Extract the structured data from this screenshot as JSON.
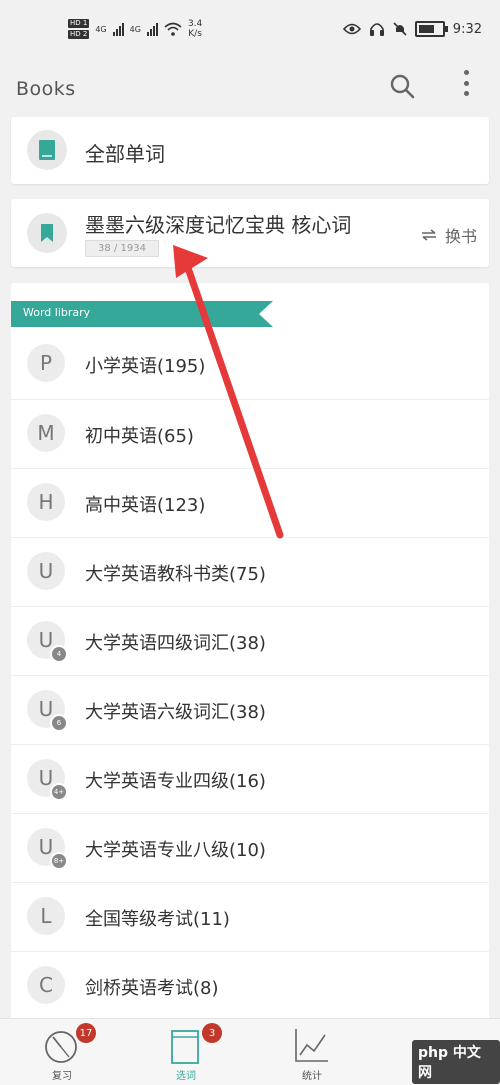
{
  "status_bar": {
    "sim_tags": [
      "HD 1",
      "HD 2"
    ],
    "network_labels": [
      "4G",
      "4G"
    ],
    "net_speed": "3.4",
    "net_speed_unit": "K/s",
    "battery_level": 0.85,
    "time": "9:32"
  },
  "app_bar": {
    "title": "Books"
  },
  "all_words": {
    "label": "全部单词"
  },
  "current_book": {
    "title": "墨墨六级深度记忆宝典 核心词",
    "progress": "38 / 1934",
    "switch_label": "换书"
  },
  "library": {
    "header": "Word library",
    "items": [
      {
        "letter": "P",
        "badge": "",
        "label": "小学英语(195)"
      },
      {
        "letter": "M",
        "badge": "",
        "label": "初中英语(65)"
      },
      {
        "letter": "H",
        "badge": "",
        "label": "高中英语(123)"
      },
      {
        "letter": "U",
        "badge": "",
        "label": "大学英语教科书类(75)"
      },
      {
        "letter": "U",
        "badge": "4",
        "label": "大学英语四级词汇(38)"
      },
      {
        "letter": "U",
        "badge": "6",
        "label": "大学英语六级词汇(38)"
      },
      {
        "letter": "U",
        "badge": "4+",
        "label": "大学英语专业四级(16)"
      },
      {
        "letter": "U",
        "badge": "8+",
        "label": "大学英语专业八级(10)"
      },
      {
        "letter": "L",
        "badge": "",
        "label": "全国等级考试(11)"
      },
      {
        "letter": "C",
        "badge": "",
        "label": "剑桥英语考试(8)"
      }
    ]
  },
  "bottom_nav": {
    "review": {
      "label": "复习",
      "badge": "17"
    },
    "select": {
      "label": "选词",
      "badge": "3"
    },
    "stats": {
      "label": "统计"
    }
  },
  "watermark": "php 中文网",
  "colors": {
    "accent": "#36a89a",
    "badge_red": "#c0392b",
    "annotation_arrow": "#e5393a"
  }
}
